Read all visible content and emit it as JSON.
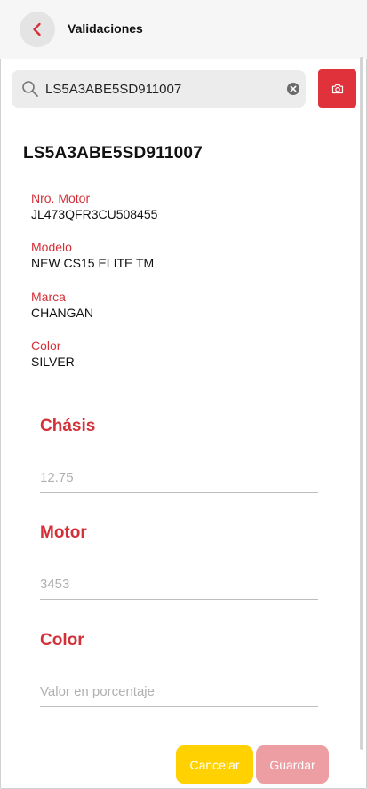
{
  "header": {
    "title": "Validaciones"
  },
  "search": {
    "value": "LS5A3ABE5SD911007"
  },
  "vehicle": {
    "vin": "LS5A3ABE5SD911007",
    "details": [
      {
        "label": "Nro. Motor",
        "value": "JL473QFR3CU508455"
      },
      {
        "label": "Modelo",
        "value": "NEW CS15 ELITE TM"
      },
      {
        "label": "Marca",
        "value": "CHANGAN"
      },
      {
        "label": "Color",
        "value": "SILVER"
      }
    ]
  },
  "form": {
    "chasis": {
      "title": "Chásis",
      "placeholder": "12.75"
    },
    "motor": {
      "title": "Motor",
      "placeholder": "3453"
    },
    "color": {
      "title": "Color",
      "placeholder": "Valor en porcentaje"
    }
  },
  "actions": {
    "cancel_label": "Cancelar",
    "save_label": "Guardar"
  },
  "colors": {
    "accent": "#d33139",
    "camera": "#e0323b",
    "cancel": "#ffd100",
    "save": "#ed9ea2"
  },
  "icons": {
    "back": "chevron-left-icon",
    "search": "search-icon",
    "clear": "clear-icon",
    "camera": "camera-icon"
  }
}
